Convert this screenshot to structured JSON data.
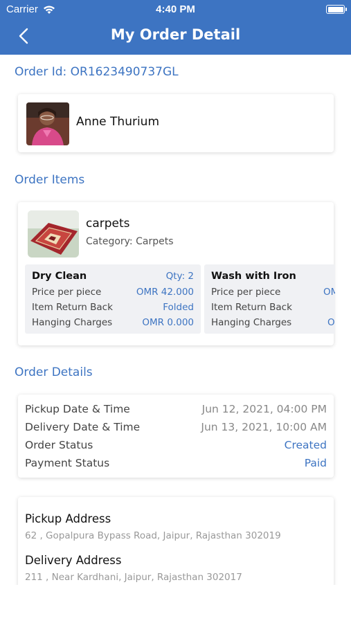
{
  "status_bar": {
    "carrier": "Carrier",
    "time": "4:40 PM",
    "wifi_icon": "wifi-icon",
    "battery_icon": "battery-icon"
  },
  "nav": {
    "title": "My Order Detail",
    "back_icon": "chevron-left-icon"
  },
  "order": {
    "id_label": "Order Id: OR1623490737GL"
  },
  "customer": {
    "name": "Anne Thurium"
  },
  "items_section": {
    "heading": "Order Items",
    "item": {
      "name": "carpets",
      "category": "Category: Carpets",
      "services": [
        {
          "name": "Dry Clean",
          "qty": "Qty: 2",
          "price_label": "Price per piece",
          "price_value": "OMR 42.000",
          "return_label": "Item Return Back",
          "return_value": "Folded",
          "hanging_label": "Hanging Charges",
          "hanging_value": "OMR 0.000"
        },
        {
          "name": "Wash with Iron",
          "qty": "",
          "price_label": "Price per piece",
          "price_value": "OMI",
          "return_label": "Item Return Back",
          "return_value": "",
          "hanging_label": "Hanging Charges",
          "hanging_value": "OM"
        }
      ]
    }
  },
  "details_section": {
    "heading": "Order Details",
    "rows": [
      {
        "label": "Pickup Date & Time",
        "value": "Jun 12, 2021, 04:00 PM"
      },
      {
        "label": "Delivery Date & Time",
        "value": "Jun 13, 2021, 10:00 AM"
      },
      {
        "label": "Order Status",
        "value": "Created"
      },
      {
        "label": "Payment Status",
        "value": "Paid"
      }
    ]
  },
  "address": {
    "pickup_label": "Pickup Address",
    "pickup_value": "62 , Gopalpura Bypass Road, Jaipur, Rajasthan 302019",
    "delivery_label": "Delivery Address",
    "delivery_value": "211 , Near Kardhani, Jaipur, Rajasthan 302017"
  },
  "colors": {
    "accent": "#3d74c2",
    "card_bg": "#ffffff",
    "service_bg": "#f0f1f4"
  }
}
